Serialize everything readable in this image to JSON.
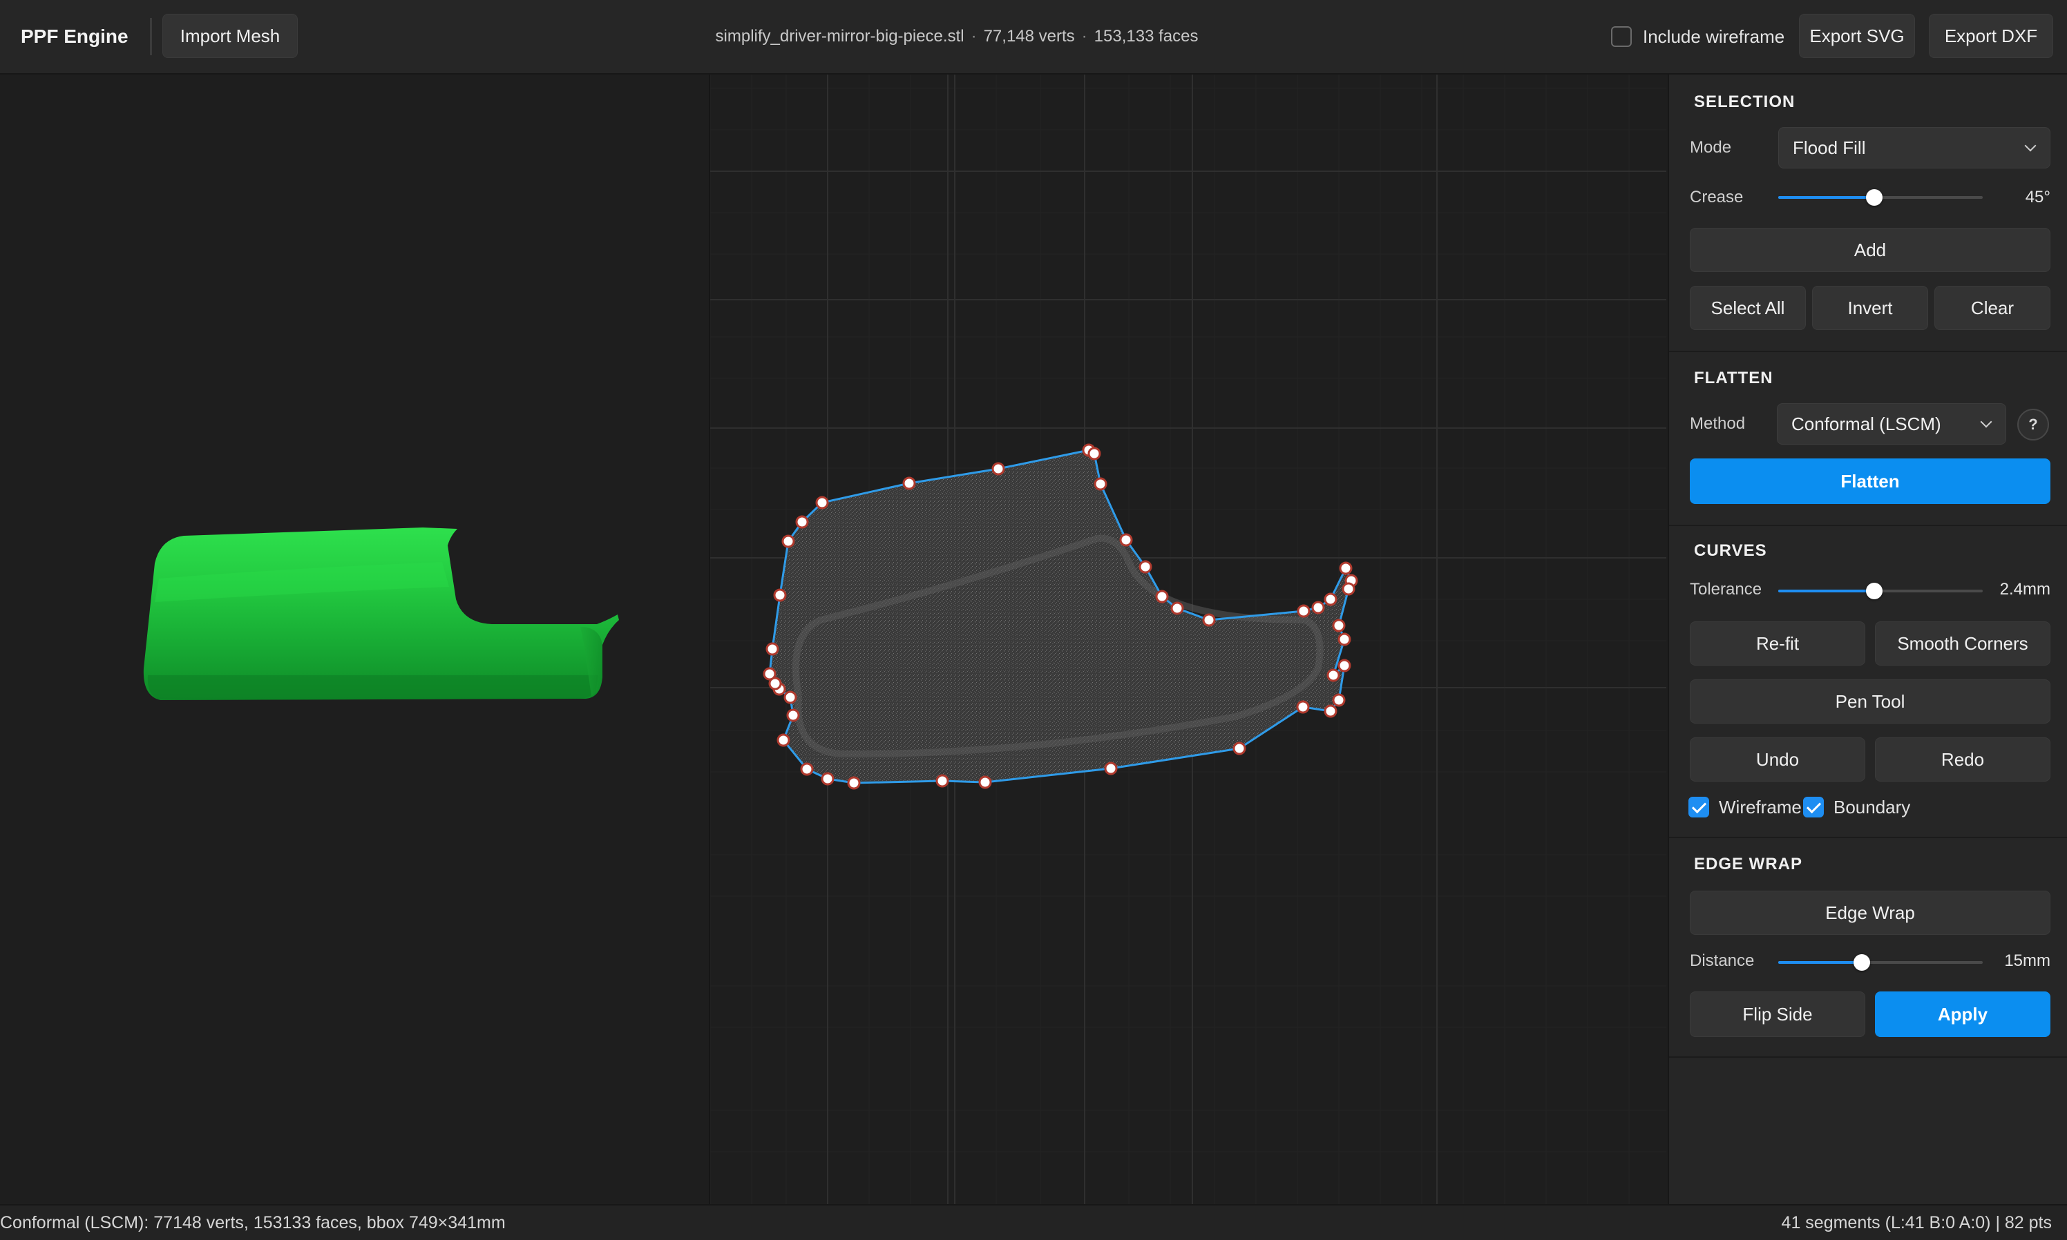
{
  "app": {
    "name": "PPF Engine"
  },
  "toolbar": {
    "import_label": "Import Mesh",
    "file_name": "simplify_driver-mirror-big-piece.stl",
    "verts": "77,148 verts",
    "faces": "153,133 faces",
    "separator": "·",
    "include_wireframe_label": "Include wireframe",
    "include_wireframe_checked": false,
    "export_svg_label": "Export SVG",
    "export_dxf_label": "Export DXF"
  },
  "viewport_3d": {
    "mesh_color": "#1fc03a",
    "mesh_highlight": "#38e35a"
  },
  "viewport_2d": {
    "boundary_color": "#2f9be8",
    "point_fill": "#ffffff",
    "point_stroke": "#b03a2e"
  },
  "selection": {
    "title": "SELECTION",
    "mode_label": "Mode",
    "mode_value": "Flood Fill",
    "crease_label": "Crease",
    "crease_fraction": 0.47,
    "crease_value": "45°",
    "add_label": "Add",
    "select_all_label": "Select All",
    "invert_label": "Invert",
    "clear_label": "Clear"
  },
  "flatten": {
    "title": "FLATTEN",
    "method_label": "Method",
    "method_value": "Conformal (LSCM)",
    "help_label": "?",
    "flatten_label": "Flatten"
  },
  "curves": {
    "title": "CURVES",
    "tolerance_label": "Tolerance",
    "tolerance_fraction": 0.47,
    "tolerance_value": "2.4mm",
    "refit_label": "Re-fit",
    "smooth_label": "Smooth Corners",
    "pen_label": "Pen Tool",
    "undo_label": "Undo",
    "redo_label": "Redo",
    "wireframe_label": "Wireframe",
    "wireframe_checked": true,
    "boundary_label": "Boundary",
    "boundary_checked": true
  },
  "edge_wrap": {
    "title": "EDGE WRAP",
    "edge_wrap_label": "Edge Wrap",
    "distance_label": "Distance",
    "distance_fraction": 0.41,
    "distance_value": "15mm",
    "flip_label": "Flip Side",
    "apply_label": "Apply"
  },
  "status": {
    "left": "Conformal (LSCM): 77148 verts, 153133 faces, bbox 749×341mm",
    "right": "41 segments (L:41 B:0 A:0) | 82 pts"
  },
  "colors": {
    "accent": "#0b8ef0",
    "background": "#1e1e1e",
    "panel": "#262626"
  }
}
